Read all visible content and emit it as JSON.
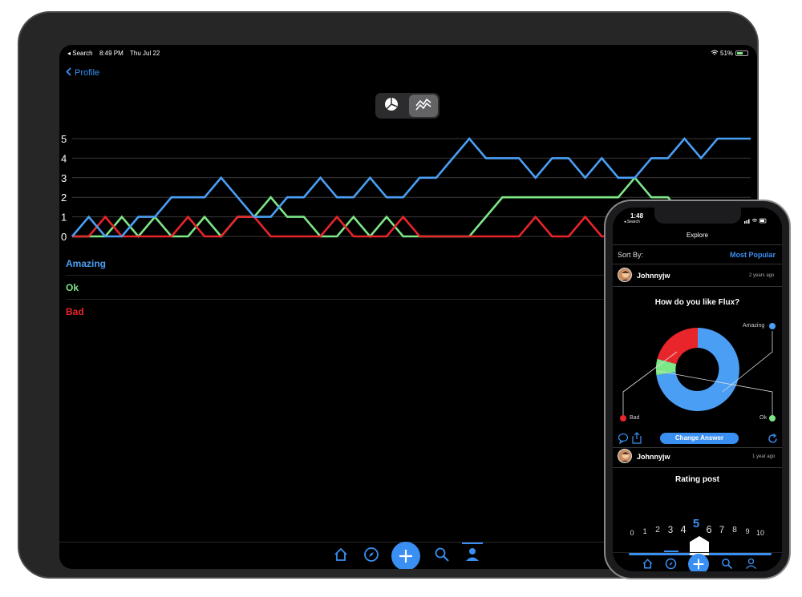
{
  "ipad": {
    "status": {
      "carrier": "◂ Search",
      "time": "8:49 PM",
      "date": "Thu Jul 22",
      "battery": "51%"
    },
    "nav": {
      "back_label": "Profile"
    },
    "legend": [
      "Amazing",
      "Ok",
      "Bad"
    ]
  },
  "chart_data": {
    "type": "line",
    "x": [
      1,
      2,
      3,
      4,
      5,
      6,
      7,
      8,
      9,
      10,
      11,
      12,
      13,
      14,
      15,
      16,
      17,
      18,
      19,
      20,
      21,
      22,
      23,
      24,
      25,
      26,
      27,
      28,
      29,
      30,
      31,
      32,
      33,
      34,
      35,
      36,
      37,
      38,
      39,
      40,
      41,
      42
    ],
    "ylim": [
      0,
      5
    ],
    "yticks": [
      0,
      1,
      2,
      3,
      4,
      5
    ],
    "grid": true,
    "series": [
      {
        "name": "Amazing",
        "color": "#4a9ff5",
        "values": [
          0,
          1,
          0,
          0,
          1,
          1,
          2,
          2,
          2,
          3,
          2,
          1,
          1,
          2,
          2,
          3,
          2,
          2,
          3,
          2,
          2,
          3,
          3,
          4,
          5,
          4,
          4,
          4,
          3,
          4,
          4,
          3,
          4,
          3,
          3,
          4,
          4,
          5,
          4,
          5,
          5,
          5
        ]
      },
      {
        "name": "Ok",
        "color": "#7ee787",
        "values": [
          0,
          0,
          0,
          1,
          0,
          1,
          0,
          0,
          1,
          0,
          1,
          1,
          2,
          1,
          1,
          0,
          0,
          1,
          0,
          1,
          0,
          0,
          0,
          0,
          0,
          1,
          2,
          2,
          2,
          2,
          2,
          2,
          2,
          2,
          3,
          2,
          2,
          1,
          1,
          1,
          1,
          1
        ]
      },
      {
        "name": "Bad",
        "color": "#e8252a",
        "values": [
          0,
          0,
          1,
          0,
          0,
          0,
          0,
          1,
          0,
          0,
          1,
          1,
          0,
          0,
          0,
          0,
          1,
          0,
          0,
          0,
          1,
          0,
          0,
          0,
          0,
          0,
          0,
          0,
          1,
          0,
          0,
          1,
          0,
          0,
          1,
          0,
          0,
          0,
          0,
          0,
          0,
          0
        ]
      }
    ]
  },
  "phone": {
    "status": {
      "time": "1:48",
      "back": "◂ Search"
    },
    "title": "Explore",
    "sort": {
      "label": "Sort By:",
      "value": "Most Popular"
    },
    "post1": {
      "user": "Johnnyjw",
      "age": "2 years ago",
      "question": "How do you like Flux?",
      "labels": {
        "amazing": "Amazing",
        "bad": "Bad",
        "ok": "Ok"
      },
      "change_label": "Change Answer"
    },
    "post2": {
      "user": "Johnnyjw",
      "age": "1 year ago",
      "title": "Rating post"
    },
    "rating": {
      "numbers": [
        "0",
        "1",
        "2",
        "3",
        "4",
        "5",
        "6",
        "7",
        "8",
        "9",
        "10"
      ],
      "selected": "5"
    }
  },
  "colors": {
    "accent": "#3a8ff3",
    "amazing": "#4a9ff5",
    "ok": "#7ee787",
    "bad": "#e8252a"
  },
  "icons": [
    "chevron-left-icon",
    "pie-chart-icon",
    "line-chart-icon",
    "home-icon",
    "compass-icon",
    "plus-icon",
    "search-icon",
    "profile-icon",
    "comment-icon",
    "share-icon",
    "refresh-icon"
  ]
}
